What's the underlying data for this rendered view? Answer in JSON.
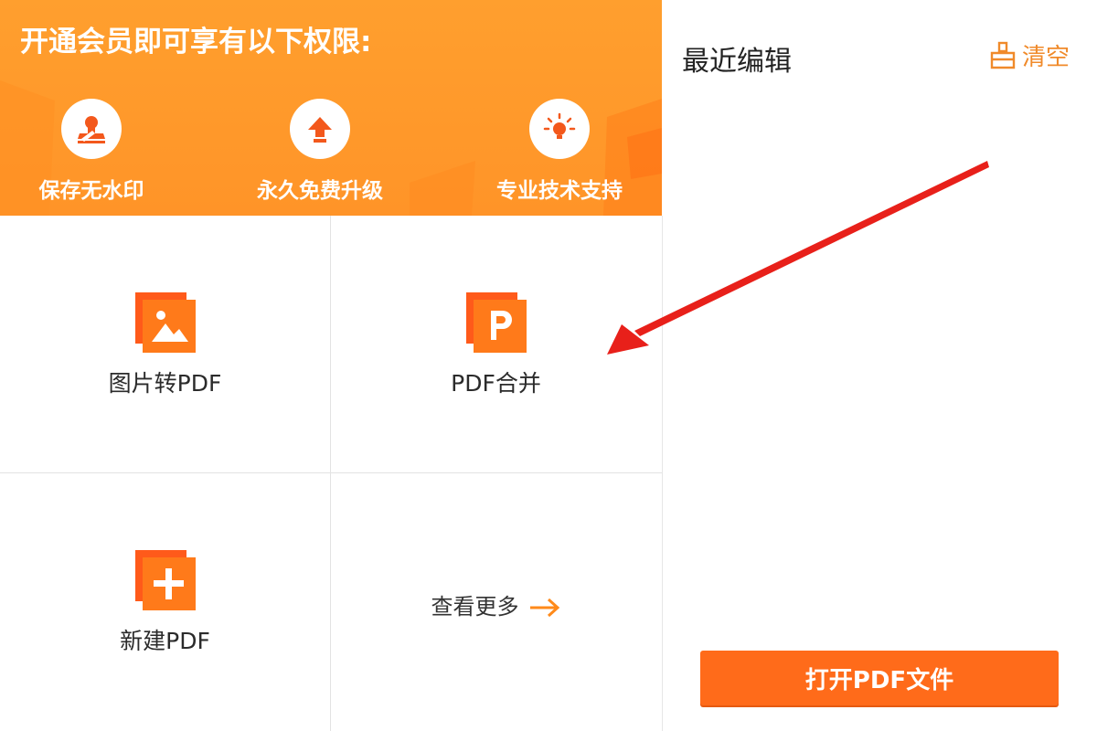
{
  "banner": {
    "title": "开通会员即可享有以下权限:",
    "perks": [
      {
        "label": "保存无水印",
        "icon": "stamp-icon"
      },
      {
        "label": "永久免费升级",
        "icon": "upgrade-arrow-icon"
      },
      {
        "label": "专业技术支持",
        "icon": "lightbulb-icon"
      }
    ]
  },
  "tools": [
    {
      "label": "图片转PDF",
      "icon": "image-icon"
    },
    {
      "label": "PDF合并",
      "icon": "pdf-p-icon"
    },
    {
      "label": "新建PDF",
      "icon": "plus-icon"
    }
  ],
  "more": {
    "label": "查看更多",
    "icon": "arrow-right-icon"
  },
  "recent": {
    "title": "最近编辑",
    "clear_label": "清空",
    "clear_icon": "broom-icon"
  },
  "open_button": "打开PDF文件",
  "colors": {
    "banner": "#ff9a2c",
    "tile_front": "#ff7a1a",
    "tile_back": "#ff5a1a",
    "button": "#ff6b1a",
    "annotation_arrow": "#e8201a"
  }
}
